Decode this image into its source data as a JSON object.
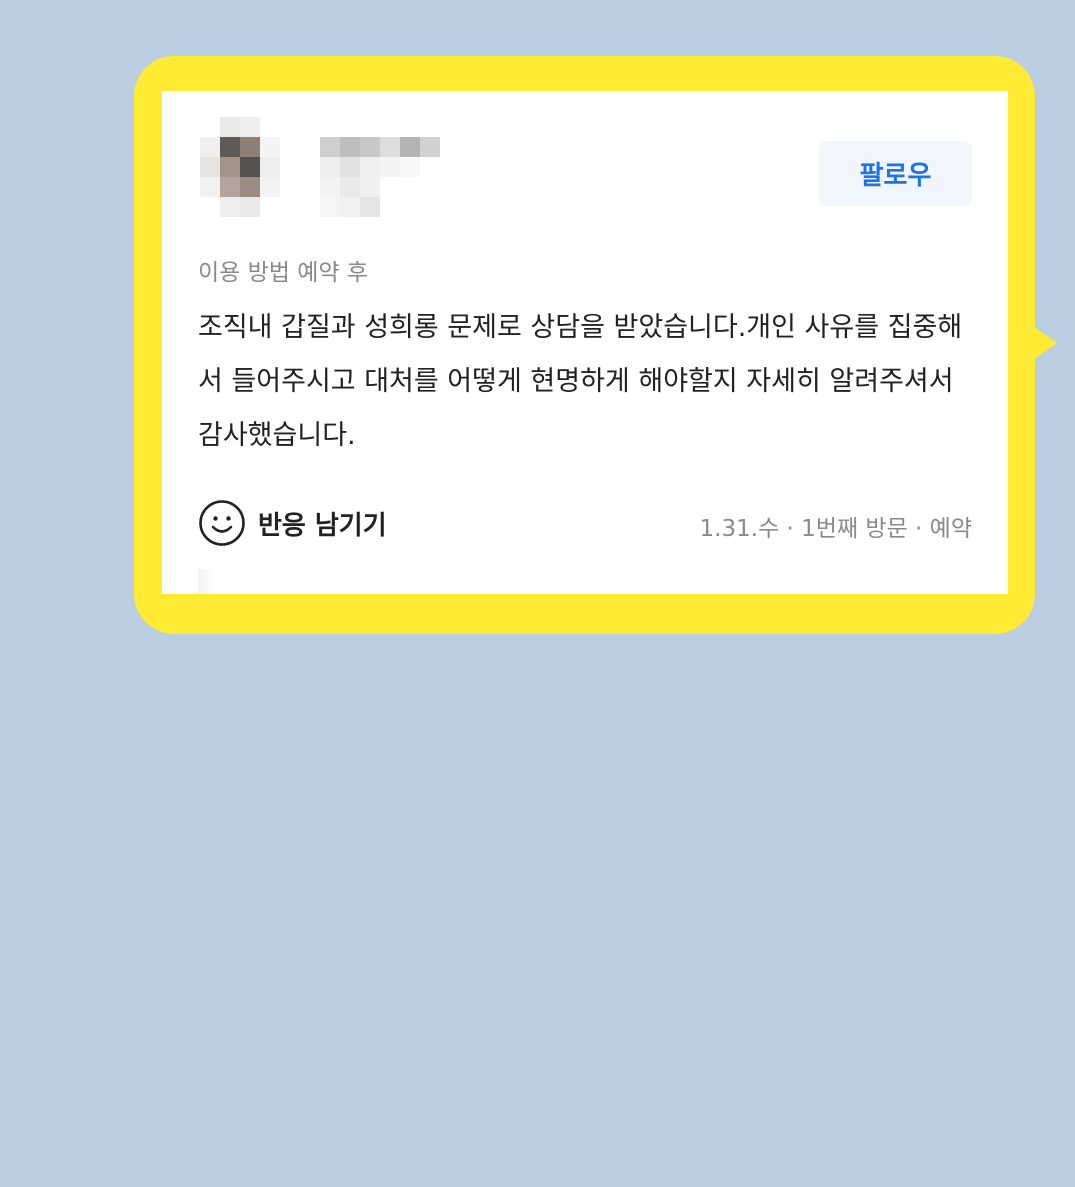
{
  "review": {
    "follow_label": "팔로우",
    "meta_label": "이용 방법 예약 후",
    "text": "조직내 갑질과 성희롱 문제로 상담을 받았습니다.개인 사유를 집중해서 들어주시고 대처를 어떻게 현명하게 해야할지 자세히 알려주셔서 감사했습니다.",
    "reaction_label": "반응 남기기",
    "visit_info": "1.31.수 · 1번째 방문 · 예약"
  },
  "icons": {
    "smile": "smile-icon",
    "avatar": "avatar-blurred"
  },
  "colors": {
    "background": "#bbcde0",
    "bubble": "#ffeb33",
    "follow_text": "#1a73e8",
    "follow_bg": "#f1f6fc"
  }
}
